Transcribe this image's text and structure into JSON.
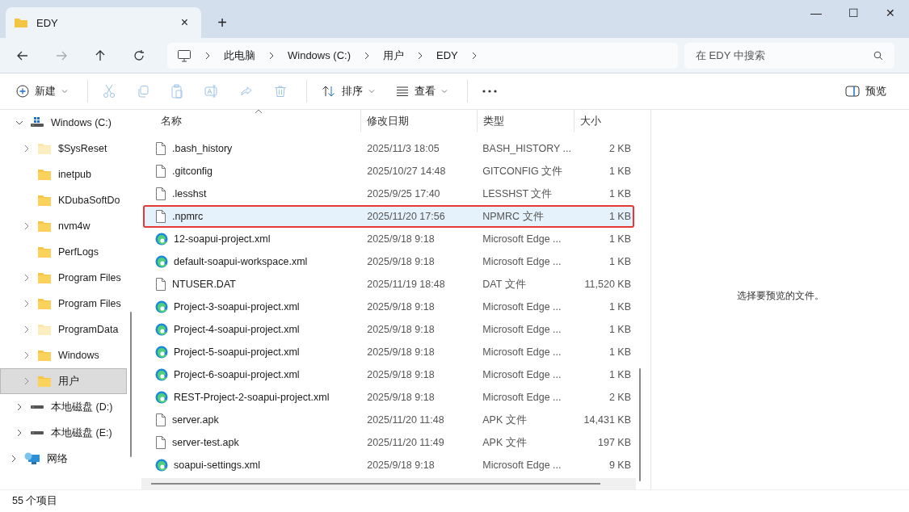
{
  "tab": {
    "title": "EDY",
    "close": "×",
    "new_tab": "+"
  },
  "window_controls": {
    "minimize": "—",
    "maximize": "☐",
    "close": "✕"
  },
  "breadcrumb": [
    "此电脑",
    "Windows (C:)",
    "用户",
    "EDY"
  ],
  "search": {
    "placeholder": "在 EDY 中搜索"
  },
  "toolbar": [
    {
      "kind": "new",
      "label": "新建",
      "disabled": false
    },
    {
      "kind": "cut",
      "disabled": true
    },
    {
      "kind": "copy",
      "disabled": true
    },
    {
      "kind": "paste",
      "disabled": true
    },
    {
      "kind": "rename",
      "disabled": true
    },
    {
      "kind": "share",
      "disabled": true
    },
    {
      "kind": "delete",
      "disabled": true
    },
    {
      "kind": "sort",
      "label": "排序",
      "disabled": false
    },
    {
      "kind": "view",
      "label": "查看",
      "disabled": false
    },
    {
      "kind": "more",
      "disabled": false
    }
  ],
  "preview_button": "预览",
  "sidebar": [
    {
      "label": "Windows (C:)",
      "kind": "drive",
      "expandable": true,
      "expanded": true,
      "selected": false,
      "children": [
        {
          "label": "$SysReset",
          "kind": "folder",
          "hidden": true,
          "expandable": true,
          "selected": false
        },
        {
          "label": "inetpub",
          "kind": "folder",
          "hidden": false,
          "expandable": false,
          "selected": false
        },
        {
          "label": "KDubaSoftDo",
          "kind": "folder",
          "hidden": false,
          "expandable": false,
          "selected": false
        },
        {
          "label": "nvm4w",
          "kind": "folder",
          "hidden": false,
          "expandable": true,
          "selected": false
        },
        {
          "label": "PerfLogs",
          "kind": "folder",
          "hidden": false,
          "expandable": false,
          "selected": false
        },
        {
          "label": "Program Files",
          "kind": "folder",
          "hidden": false,
          "expandable": true,
          "selected": false
        },
        {
          "label": "Program Files",
          "kind": "folder",
          "hidden": false,
          "expandable": true,
          "selected": false
        },
        {
          "label": "ProgramData",
          "kind": "folder",
          "hidden": true,
          "expandable": true,
          "selected": false
        },
        {
          "label": "Windows",
          "kind": "folder",
          "hidden": false,
          "expandable": true,
          "selected": false
        },
        {
          "label": "用户",
          "kind": "folder",
          "hidden": false,
          "expandable": true,
          "selected": true
        }
      ]
    },
    {
      "label": "本地磁盘 (D:)",
      "kind": "drive",
      "expandable": true,
      "expanded": false,
      "selected": false
    },
    {
      "label": "本地磁盘 (E:)",
      "kind": "drive",
      "expandable": true,
      "expanded": false,
      "selected": false
    }
  ],
  "sidebar_network": {
    "label": "网络",
    "kind": "network",
    "expandable": true,
    "selected": false
  },
  "table": {
    "columns": [
      "名称",
      "修改日期",
      "类型",
      "大小"
    ],
    "rows": [
      {
        "kind": "file",
        "name": ".bash_history",
        "date": "2025/11/3 18:05",
        "type": "BASH_HISTORY ...",
        "size": "2 KB",
        "selected": false,
        "outlined": false
      },
      {
        "kind": "file",
        "name": ".gitconfig",
        "date": "2025/10/27 14:48",
        "type": "GITCONFIG 文件",
        "size": "1 KB",
        "selected": false,
        "outlined": false
      },
      {
        "kind": "file",
        "name": ".lesshst",
        "date": "2025/9/25 17:40",
        "type": "LESSHST 文件",
        "size": "1 KB",
        "selected": false,
        "outlined": false
      },
      {
        "kind": "file",
        "name": ".npmrc",
        "date": "2025/11/20 17:56",
        "type": "NPMRC 文件",
        "size": "1 KB",
        "selected": true,
        "outlined": true
      },
      {
        "kind": "edge",
        "name": "12-soapui-project.xml",
        "date": "2025/9/18 9:18",
        "type": "Microsoft Edge ...",
        "size": "1 KB",
        "selected": false,
        "outlined": false
      },
      {
        "kind": "edge",
        "name": "default-soapui-workspace.xml",
        "date": "2025/9/18 9:18",
        "type": "Microsoft Edge ...",
        "size": "1 KB",
        "selected": false,
        "outlined": false
      },
      {
        "kind": "file",
        "name": "NTUSER.DAT",
        "date": "2025/11/19 18:48",
        "type": "DAT 文件",
        "size": "11,520 KB",
        "selected": false,
        "outlined": false
      },
      {
        "kind": "edge",
        "name": "Project-3-soapui-project.xml",
        "date": "2025/9/18 9:18",
        "type": "Microsoft Edge ...",
        "size": "1 KB",
        "selected": false,
        "outlined": false
      },
      {
        "kind": "edge",
        "name": "Project-4-soapui-project.xml",
        "date": "2025/9/18 9:18",
        "type": "Microsoft Edge ...",
        "size": "1 KB",
        "selected": false,
        "outlined": false
      },
      {
        "kind": "edge",
        "name": "Project-5-soapui-project.xml",
        "date": "2025/9/18 9:18",
        "type": "Microsoft Edge ...",
        "size": "1 KB",
        "selected": false,
        "outlined": false
      },
      {
        "kind": "edge",
        "name": "Project-6-soapui-project.xml",
        "date": "2025/9/18 9:18",
        "type": "Microsoft Edge ...",
        "size": "1 KB",
        "selected": false,
        "outlined": false
      },
      {
        "kind": "edge",
        "name": "REST-Project-2-soapui-project.xml",
        "date": "2025/9/18 9:18",
        "type": "Microsoft Edge ...",
        "size": "2 KB",
        "selected": false,
        "outlined": false
      },
      {
        "kind": "file",
        "name": "server.apk",
        "date": "2025/11/20 11:48",
        "type": "APK 文件",
        "size": "14,431 KB",
        "selected": false,
        "outlined": false
      },
      {
        "kind": "file",
        "name": "server-test.apk",
        "date": "2025/11/20 11:49",
        "type": "APK 文件",
        "size": "197 KB",
        "selected": false,
        "outlined": false
      },
      {
        "kind": "edge",
        "name": "soapui-settings.xml",
        "date": "2025/9/18 9:18",
        "type": "Microsoft Edge ...",
        "size": "9 KB",
        "selected": false,
        "outlined": false
      }
    ]
  },
  "preview_message": "选择要预览的文件。",
  "status_bar": "55 个项目"
}
